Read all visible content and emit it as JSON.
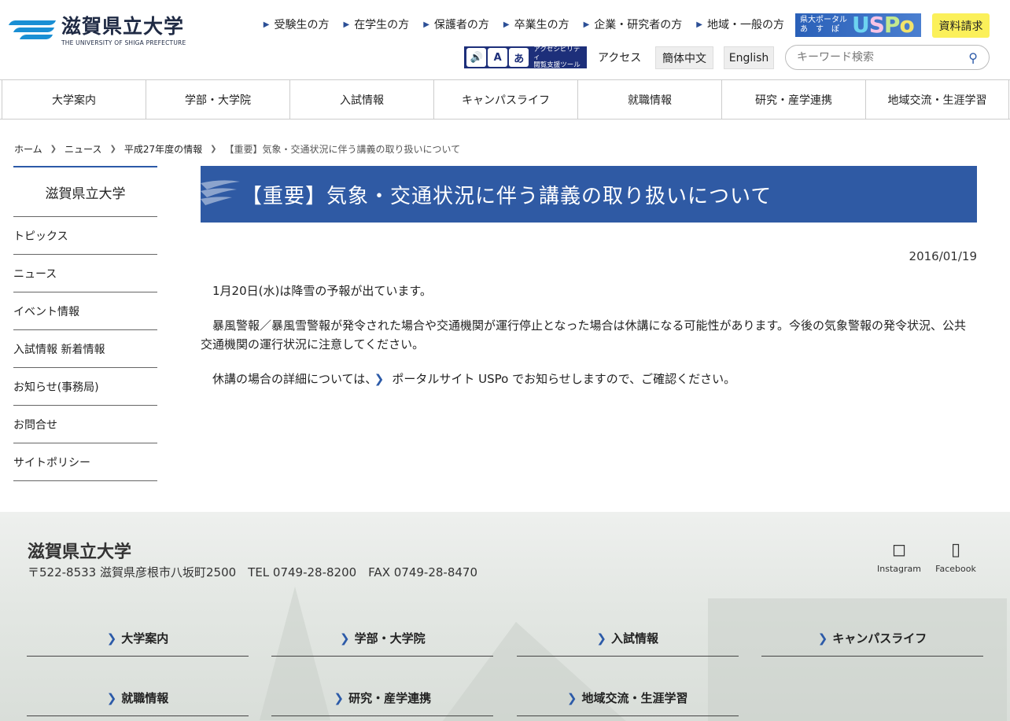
{
  "header": {
    "logo_jp": "滋賀県立大学",
    "logo_en": "THE UNIVERSITY OF SHIGA PREFECTURE",
    "top_links": [
      "受験生の方",
      "在学生の方",
      "保護者の方",
      "卒業生の方",
      "企業・研究者の方",
      "地域・一般の方"
    ],
    "uspo_small": "県大ポータル\nあ　す　ぽ",
    "uspo_u": "U",
    "uspo_s": "S",
    "uspo_p": "P",
    "uspo_o": "o",
    "request_label": "資料請求",
    "access_tool_label": "アクセシビリティ\n閲覧支援ツール",
    "access_label": "アクセス",
    "lang_zh": "簡体中文",
    "lang_en": "English",
    "search_placeholder": "キーワード検索"
  },
  "gnav": [
    "大学案内",
    "学部・大学院",
    "入試情報",
    "キャンパスライフ",
    "就職情報",
    "研究・産学連携",
    "地域交流・生涯学習"
  ],
  "breadcrumb": [
    "ホーム",
    "ニュース",
    "平成27年度の情報",
    "【重要】気象・交通状況に伴う講義の取り扱いについて"
  ],
  "sidebar": {
    "title": "滋賀県立大学",
    "items": [
      "トピックス",
      "ニュース",
      "イベント情報",
      "入試情報 新着情報",
      "お知らせ(事務局)",
      "お問合せ",
      "サイトポリシー"
    ]
  },
  "article": {
    "title": "【重要】気象・交通状況に伴う講義の取り扱いについて",
    "date": "2016/01/19",
    "p1": "1月20日(水)は降雪の予報が出ています。",
    "p2": "暴風警報／暴風雪警報が発令された場合や交通機関が運行停止となった場合は休講になる可能性があります。今後の気象警報の発令状況、公共交通機関の運行状況に注意してください。",
    "p3_pre": "休講の場合の詳細については、",
    "p3_link": "ポータルサイト USPo",
    "p3_post": " でお知らせしますので、ご確認ください。"
  },
  "footer": {
    "name": "滋賀県立大学",
    "address": "〒522-8533 滋賀県彦根市八坂町2500　TEL 0749-28-8200　FAX 0749-28-8470",
    "sns": [
      "Instagram",
      "Facebook"
    ],
    "nav_row1": [
      "大学案内",
      "学部・大学院",
      "入試情報",
      "キャンパスライフ"
    ],
    "nav_row2": [
      "就職情報",
      "研究・産学連携",
      "地域交流・生涯学習"
    ]
  },
  "colors": {
    "brand_blue": "#2f5aa4",
    "request_yellow": "#fbf05a",
    "logo_blue": "#1a8fd4"
  }
}
